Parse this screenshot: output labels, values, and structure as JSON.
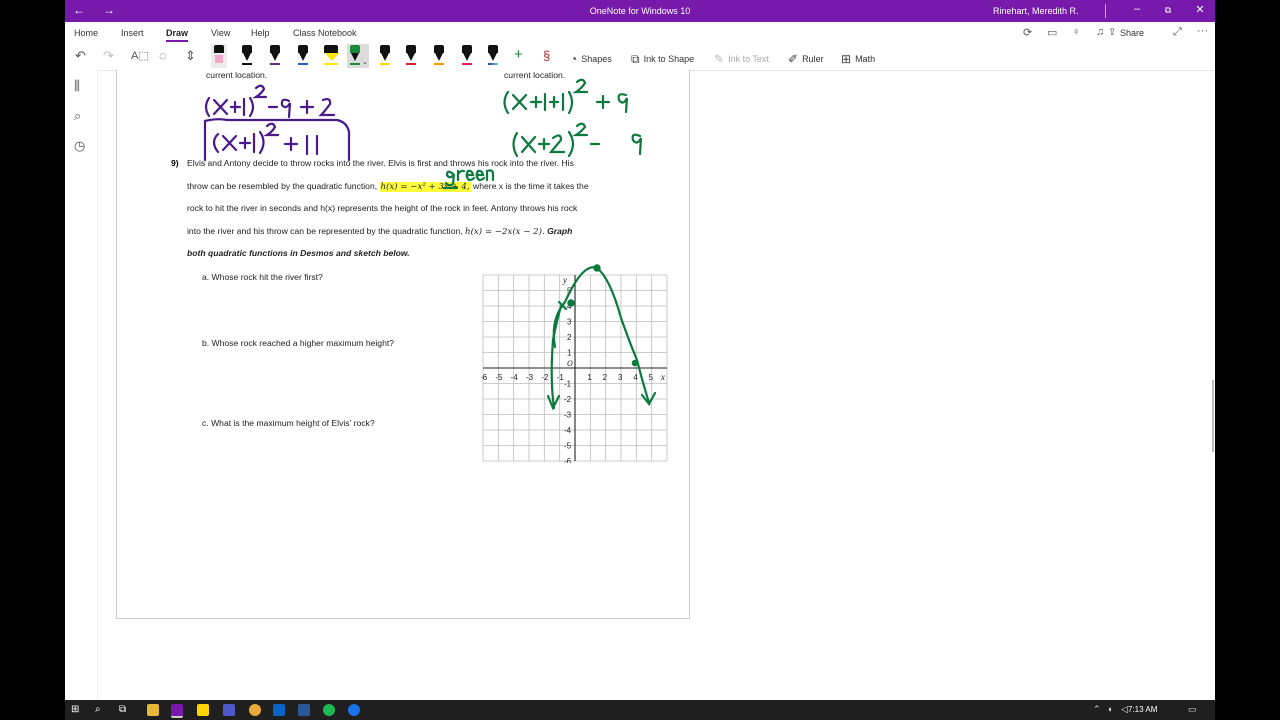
{
  "window": {
    "title": "OneNote for Windows 10",
    "user": "Rinehart, Meredith R.",
    "nav_back": "←",
    "nav_forward": "→",
    "minimize": "–",
    "maximize": "⧉",
    "close": "✕"
  },
  "menu": {
    "tabs": [
      "Home",
      "Insert",
      "Draw",
      "View",
      "Help",
      "Class Notebook"
    ],
    "active_tab": "Draw",
    "share_label": "Share",
    "more": "···"
  },
  "ribbon": {
    "shapes": "Shapes",
    "ink_to_shape": "Ink to Shape",
    "ink_to_text": "Ink to Text",
    "ruler": "Ruler",
    "math": "Math",
    "pen_colors": [
      "#111111",
      "#111111",
      "#5b2d8e",
      "#1f5fbf",
      "#ffe600",
      "#1a8a3a",
      "#ffd400",
      "#d6252b",
      "#ff9800",
      "#e91e63",
      "#222222"
    ]
  },
  "doc": {
    "cut_left": "current location.",
    "cut_right": "current location.",
    "q_number": "9)",
    "line1": "Elvis and Antony decide to throw rocks into the river. Elvis is first and throws his rock into the river. His",
    "line2_pre": "throw can be resembled by the quadratic function,",
    "line2_eq": "h(x) = −x² + 3x + 4,",
    "line2_post": "where x is the time it takes the",
    "line3": "rock to hit the river in seconds and h(x) represents the height of the rock in feet. Antony throws his rock",
    "line4_pre": "into the river and his throw can be represented by the quadratic function,",
    "line4_eq": "h(x) = −2x(x − 2).",
    "line4_bold": "Graph",
    "line5": "both quadratic functions in Desmos and sketch below.",
    "qa": "a.   Whose rock hit the river first?",
    "qb": "b.   Whose rock reached a higher maximum height?",
    "qc": "c.   What is the maximum height of Elvis' rock?"
  },
  "ink": {
    "purple_line1": "(x+1)²-9+2",
    "purple_line2": "(x+1)²+11",
    "green_line1": "(x+1+1)²+9",
    "green_line2": "(x+2)²-9",
    "green_word": "green"
  },
  "grid": {
    "x_ticks": [
      "-6",
      "-5",
      "-4",
      "-3",
      "-2",
      "-1",
      "1",
      "2",
      "3",
      "4",
      "5"
    ],
    "y_ticks": [
      "5",
      "4",
      "3",
      "2",
      "1",
      "-1",
      "-2",
      "-3",
      "-4",
      "-5",
      "-6"
    ],
    "x_label": "x",
    "y_label": "y",
    "origin": "O"
  },
  "taskbar": {
    "time": "7:13 AM"
  }
}
